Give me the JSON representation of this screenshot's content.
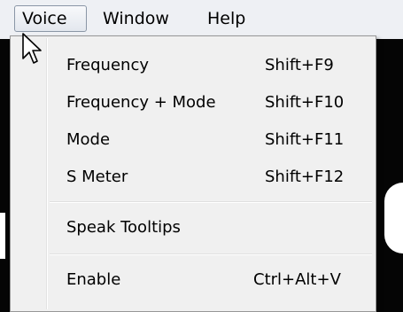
{
  "menubar": {
    "items": [
      {
        "label": "Voice"
      },
      {
        "label": "Window"
      },
      {
        "label": "Help"
      }
    ]
  },
  "voice_menu": {
    "items": [
      {
        "label": "Frequency",
        "shortcut": "Shift+F9"
      },
      {
        "label": "Frequency + Mode",
        "shortcut": "Shift+F10"
      },
      {
        "label": "Mode",
        "shortcut": "Shift+F11"
      },
      {
        "label": "S Meter",
        "shortcut": "Shift+F12"
      },
      {
        "label": "Speak Tooltips",
        "shortcut": ""
      },
      {
        "label": "Enable",
        "shortcut": "Ctrl+Alt+V"
      }
    ]
  },
  "icons": {
    "cursor": "arrow-cursor-icon"
  },
  "colors": {
    "menu_background": "#f0f0f0",
    "menubar_background": "#eef0f4",
    "app_background": "#050505",
    "active_menu_border": "#8a96a6"
  }
}
